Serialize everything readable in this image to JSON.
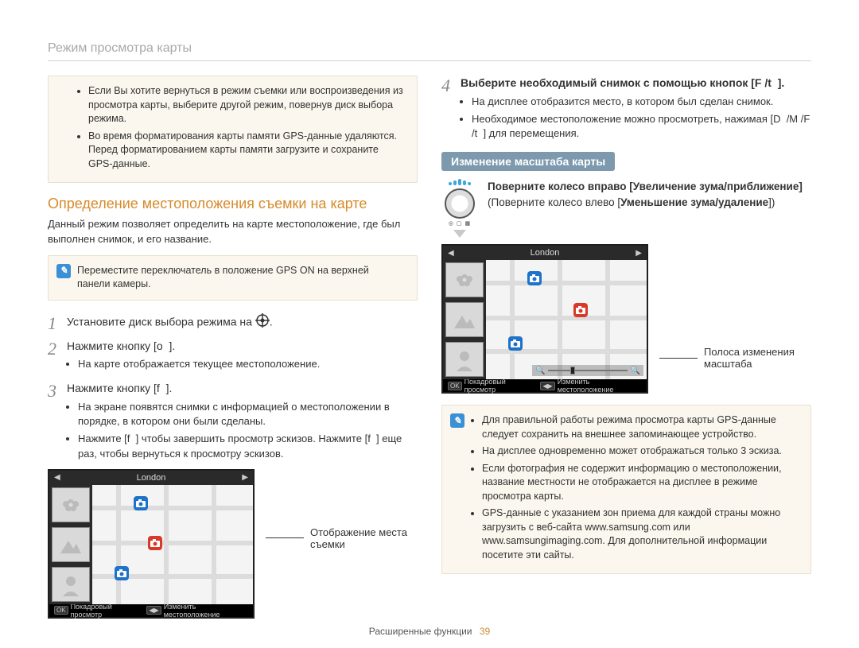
{
  "page": {
    "title": "Режим просмотра карты",
    "footer_label": "Расширенные функции",
    "footer_page": "39"
  },
  "left": {
    "warn_box": {
      "items": [
        "Если Вы хотите вернуться в режим съемки или воспроизведения из просмотра карты, выберите другой режим, повернув диск выбора режима.",
        "Во время форматирования карты памяти GPS-данные удаляются. Перед форматированием карты памяти загрузите и сохраните GPS-данные."
      ]
    },
    "section_heading": "Определение местоположения съемки на карте",
    "section_intro": "Данный режим позволяет определить на карте местоположение, где был выполнен снимок, и его название.",
    "info_box": "Переместите переключатель в положение GPS ON на верхней панели камеры.",
    "steps": {
      "s1": "Установите диск выбора режима на ",
      "s2": {
        "text": "Нажмите кнопку [o  ].",
        "bullet": "На карте отображается текущее местоположение."
      },
      "s3": {
        "text": "Нажмите кнопку [f  ].",
        "bullets": [
          "На экране появятся снимки с информацией о местоположении в порядке, в котором они были сделаны.",
          "Нажмите [f  ] чтобы завершить просмотр эскизов. Нажмите [f  ] еще раз, чтобы вернуться к просмотру эскизов."
        ]
      }
    },
    "screen": {
      "location": "London",
      "bottombar_left": "Покадровый просмотр",
      "bottombar_right": "Изменить местоположение",
      "ok": "OK"
    },
    "callout_camera": "Отображение места съемки"
  },
  "right": {
    "step4": {
      "text": "Выберите необходимый снимок с помощью кнопок [F /t  ].",
      "bullets": [
        "На дисплее отобразится место, в котором был сделан снимок.",
        "Необходимое местоположение можно просмотреть, нажимая [D  /M /F /t  ] для перемещения."
      ]
    },
    "subheading": "Изменение масштаба карты",
    "wheel": {
      "line1_bold": "Поверните колесо вправо [Увеличение зума/приближение]",
      "line2_part1": "(Поверните колесо влево [",
      "line2_bold": "Уменьшение зума/удаление",
      "line2_part2": "])"
    },
    "screen": {
      "location": "London",
      "bottombar_left": "Покадровый просмотр",
      "bottombar_right": "Изменить местоположение",
      "ok": "OK"
    },
    "callout_slider": "Полоса изменения масштаба",
    "info_box2": {
      "items": [
        "Для правильной работы режима просмотра карты GPS-данные следует сохранить на внешнее запоминающее устройство.",
        "На дисплее одновременно может отображаться только 3 эскиза.",
        "Если фотография не содержит информацию о местоположении, название местности не отображается на дисплее в режиме просмотра карты.",
        "GPS-данные с указанием зон приема для каждой страны можно загрузить с веб-сайта www.samsung.com или www.samsungimaging.com. Для дополнительной информации посетите эти сайты."
      ]
    }
  }
}
